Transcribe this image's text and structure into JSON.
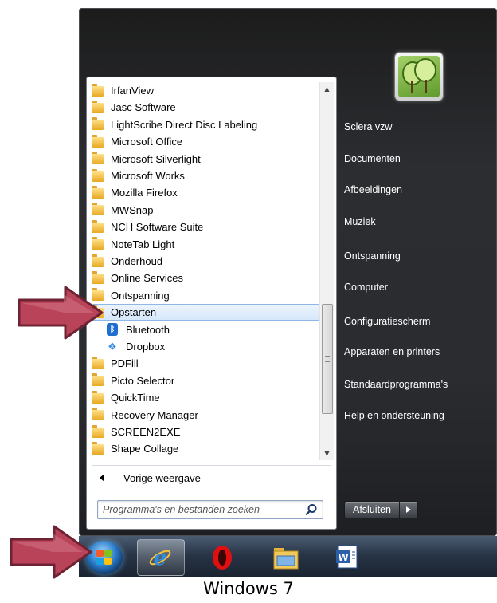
{
  "programs": [
    {
      "label": "IrfanView",
      "icon": "folder-icon",
      "indent": false
    },
    {
      "label": "Jasc Software",
      "icon": "folder-icon",
      "indent": false
    },
    {
      "label": "LightScribe Direct Disc Labeling",
      "icon": "folder-icon",
      "indent": false
    },
    {
      "label": "Microsoft Office",
      "icon": "folder-icon",
      "indent": false
    },
    {
      "label": "Microsoft Silverlight",
      "icon": "folder-icon",
      "indent": false
    },
    {
      "label": "Microsoft Works",
      "icon": "folder-icon",
      "indent": false
    },
    {
      "label": "Mozilla Firefox",
      "icon": "folder-icon",
      "indent": false
    },
    {
      "label": "MWSnap",
      "icon": "folder-icon",
      "indent": false
    },
    {
      "label": "NCH Software Suite",
      "icon": "folder-icon",
      "indent": false
    },
    {
      "label": "NoteTab Light",
      "icon": "folder-icon",
      "indent": false
    },
    {
      "label": "Onderhoud",
      "icon": "folder-icon",
      "indent": false
    },
    {
      "label": "Online Services",
      "icon": "folder-icon",
      "indent": false
    },
    {
      "label": "Ontspanning",
      "icon": "folder-icon",
      "indent": false
    },
    {
      "label": "Opstarten",
      "icon": "folder-icon",
      "indent": false,
      "selected": true
    },
    {
      "label": "Bluetooth",
      "icon": "bluetooth-icon",
      "indent": true
    },
    {
      "label": "Dropbox",
      "icon": "dropbox-icon",
      "indent": true
    },
    {
      "label": "PDFill",
      "icon": "folder-icon",
      "indent": false
    },
    {
      "label": "Picto Selector",
      "icon": "folder-icon",
      "indent": false
    },
    {
      "label": "QuickTime",
      "icon": "folder-icon",
      "indent": false
    },
    {
      "label": "Recovery Manager",
      "icon": "folder-icon",
      "indent": false
    },
    {
      "label": "SCREEN2EXE",
      "icon": "folder-icon",
      "indent": false
    },
    {
      "label": "Shape Collage",
      "icon": "folder-icon",
      "indent": false
    }
  ],
  "back_label": "Vorige weergave",
  "search": {
    "placeholder": "Programma's en bestanden zoeken"
  },
  "right_items": [
    "Sclera vzw",
    "Documenten",
    "Afbeeldingen",
    "Muziek",
    "Ontspanning",
    "Computer",
    "Configuratiescherm",
    "Apparaten en printers",
    "Standaardprogramma's",
    "Help en ondersteuning"
  ],
  "shutdown": {
    "label": "Afsluiten"
  },
  "taskbar": {
    "pinned": [
      "internet-explorer-icon",
      "opera-icon",
      "file-explorer-icon",
      "word-icon"
    ]
  },
  "caption": "Windows 7",
  "colors": {
    "arrow": "#a33b4e",
    "selection": "#d5e7fb",
    "folder": "#e8a922"
  }
}
